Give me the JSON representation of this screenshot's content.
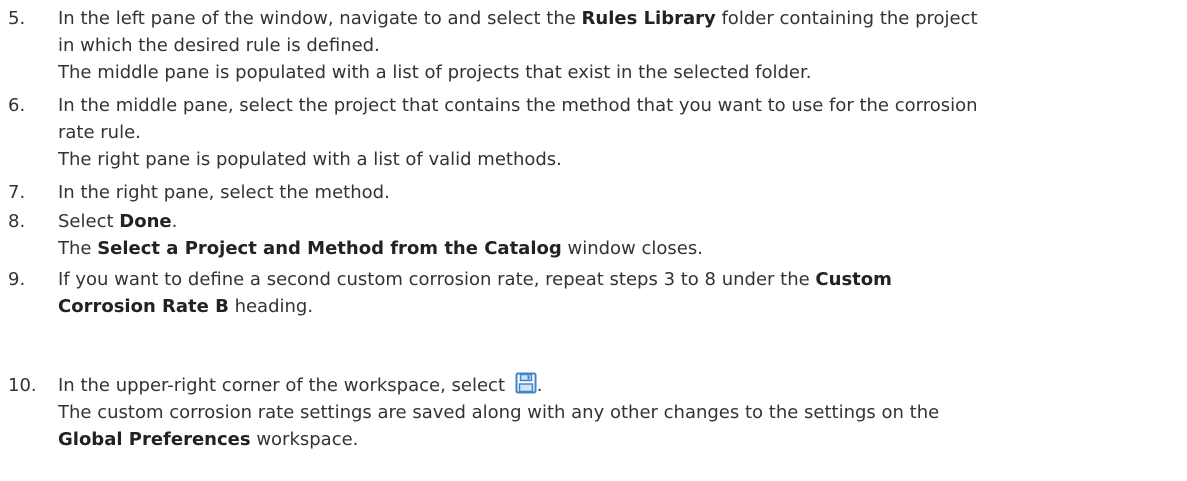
{
  "steps": [
    {
      "num": "5.",
      "lines": [
        [
          "In the left pane of the window, navigate to and select the ",
          {
            "b": "Rules Library"
          },
          " folder containing the project"
        ],
        [
          "in which the desired rule is defined."
        ],
        [
          "The middle pane is populated with a list of projects that exist in the selected folder."
        ]
      ]
    },
    {
      "num": "6.",
      "lines": [
        [
          "In the middle pane, select the project that contains the method that you want to use for the corrosion"
        ],
        [
          "rate rule."
        ],
        [
          "The right pane is populated with a list of valid methods."
        ]
      ]
    },
    {
      "num": "7.",
      "lines": [
        [
          "In the right pane, select the method."
        ]
      ]
    },
    {
      "num": "8.",
      "lines": [
        [
          "Select ",
          {
            "b": "Done"
          },
          "."
        ],
        [
          "The ",
          {
            "b": "Select a Project and Method from the Catalog"
          },
          " window closes."
        ]
      ]
    },
    {
      "num": "9.",
      "lines": [
        [
          "If you want to define a second custom corrosion rate, repeat steps 3 to 8 under the ",
          {
            "b": "Custom"
          }
        ],
        [
          {
            "b": "Corrosion Rate B"
          },
          " heading."
        ]
      ]
    },
    {
      "num": "10.",
      "lines": [
        [
          "In the upper-right corner of the workspace, select ",
          {
            "icon": "save-icon"
          },
          "."
        ],
        [
          "The custom corrosion rate settings are saved along with any other changes to the settings on the"
        ],
        [
          {
            "b": "Global Preferences"
          },
          " workspace."
        ]
      ]
    }
  ],
  "colors": {
    "text": "#333333",
    "icon_blue": "#3f86c8",
    "icon_light": "#cfe4f7"
  }
}
